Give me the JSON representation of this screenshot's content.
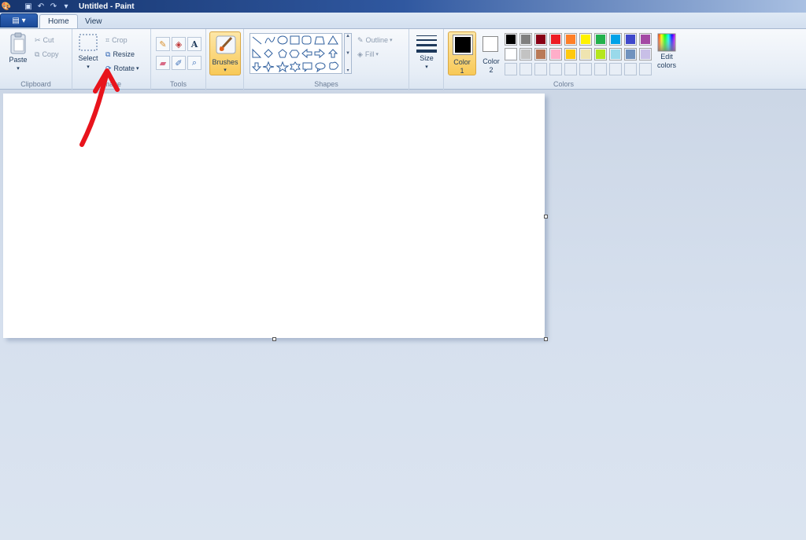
{
  "window": {
    "title": "Untitled - Paint"
  },
  "tabs": [
    {
      "label": "Home",
      "active": true
    },
    {
      "label": "View",
      "active": false
    }
  ],
  "clipboard": {
    "group_label": "Clipboard",
    "paste": "Paste",
    "cut": "Cut",
    "copy": "Copy"
  },
  "image": {
    "group_label": "Image",
    "select": "Select",
    "crop": "Crop",
    "resize": "Resize",
    "rotate": "Rotate"
  },
  "tools": {
    "group_label": "Tools"
  },
  "brushes": {
    "label": "Brushes"
  },
  "shapes": {
    "group_label": "Shapes",
    "outline": "Outline",
    "fill": "Fill"
  },
  "size": {
    "label": "Size"
  },
  "colors": {
    "group_label": "Colors",
    "color1_label": "Color",
    "color1_num": "1",
    "color2_label": "Color",
    "color2_num": "2",
    "color1_value": "#000000",
    "color2_value": "#ffffff",
    "edit_line1": "Edit",
    "edit_line2": "colors",
    "palette_row1": [
      "#000000",
      "#7f7f7f",
      "#880015",
      "#ed1c24",
      "#ff7f27",
      "#fff200",
      "#22b14c",
      "#00a2e8",
      "#3f48cc",
      "#a349a4"
    ],
    "palette_row2": [
      "#ffffff",
      "#c3c3c3",
      "#b97a57",
      "#ffaec9",
      "#ffc90e",
      "#efe4b0",
      "#b5e61d",
      "#99d9ea",
      "#7092be",
      "#c8bfe7"
    ]
  },
  "annotation": {
    "color": "#e8141c",
    "points_to": "Resize"
  }
}
